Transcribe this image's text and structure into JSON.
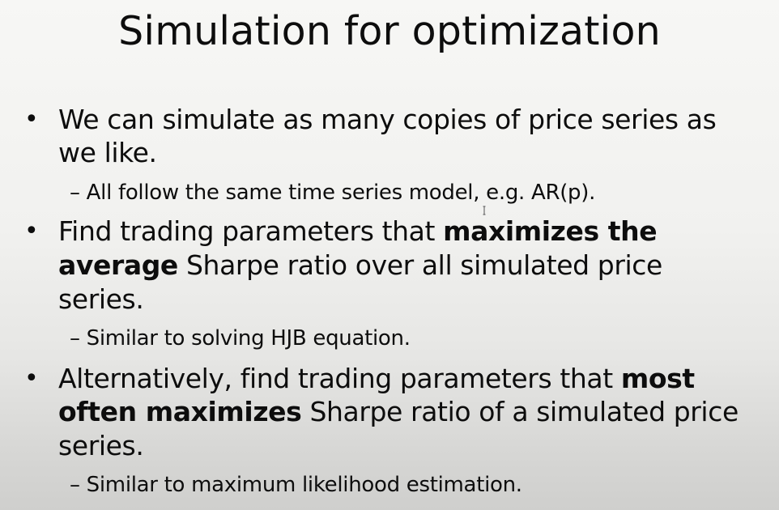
{
  "slide": {
    "title": "Simulation for optimization",
    "bullets": [
      {
        "marker": "•",
        "lines": [
          {
            "parts": [
              {
                "text": "We can simulate as many copies of price series as",
                "bold": false
              }
            ]
          },
          {
            "parts": [
              {
                "text": "we like.",
                "bold": false
              }
            ]
          }
        ],
        "sub": "– All follow the same time series model, e.g. AR(p)."
      },
      {
        "marker": "•",
        "lines": [
          {
            "parts": [
              {
                "text": "Find trading parameters that ",
                "bold": false
              },
              {
                "text": "maximizes the",
                "bold": true
              }
            ]
          },
          {
            "parts": [
              {
                "text": "average",
                "bold": true
              },
              {
                "text": " Sharpe ratio over all simulated price",
                "bold": false
              }
            ]
          },
          {
            "parts": [
              {
                "text": "series.",
                "bold": false
              }
            ]
          }
        ],
        "sub": "– Similar to solving HJB equation."
      },
      {
        "marker": "•",
        "lines": [
          {
            "parts": [
              {
                "text": "Alternatively, find trading parameters that ",
                "bold": false
              },
              {
                "text": "most",
                "bold": true
              }
            ]
          },
          {
            "parts": [
              {
                "text": "often maximizes",
                "bold": true
              },
              {
                "text": " Sharpe ratio of a simulated price",
                "bold": false
              }
            ]
          },
          {
            "parts": [
              {
                "text": "series.",
                "bold": false
              }
            ]
          }
        ],
        "sub": "– Similar to maximum likelihood estimation."
      }
    ]
  }
}
